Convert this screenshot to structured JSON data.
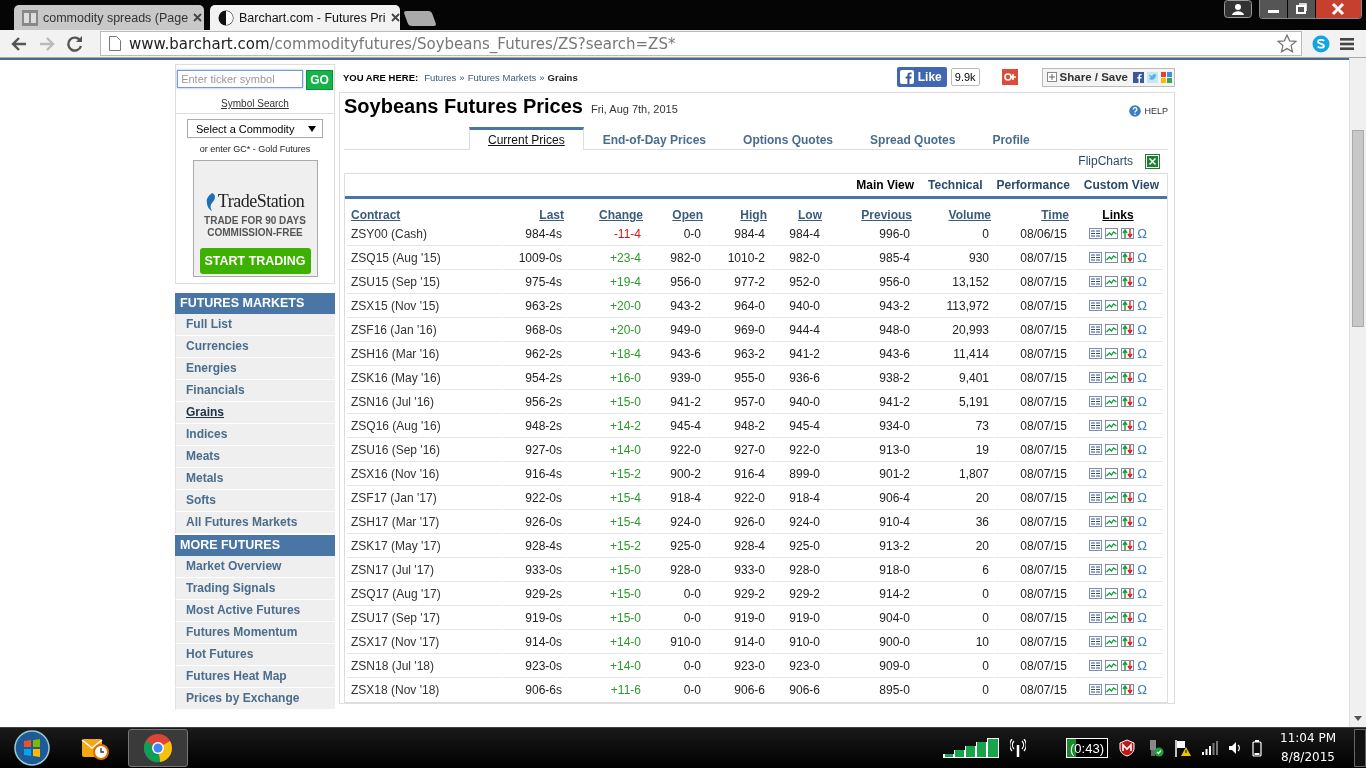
{
  "browser": {
    "tabs": [
      {
        "title": "commodity spreads (Page",
        "selected": false
      },
      {
        "title": "Barchart.com - Futures Pri",
        "selected": true
      }
    ],
    "url": {
      "host": "www.barchart.com",
      "path": "/commodityfutures/Soybeans_Futures/ZS?search=ZS*"
    }
  },
  "sidebar": {
    "search": {
      "placeholder": "Enter ticker symbol",
      "button": "GO"
    },
    "symbol_search": "Symbol Search",
    "commodity_select": "Select a Commodity",
    "hint": "or enter GC* - Gold Futures",
    "ad": {
      "brand": "TradeStation",
      "lines": [
        "TRADE FOR 90 DAYS",
        "COMMISSION-FREE"
      ],
      "button": "START TRADING"
    },
    "sections": [
      {
        "heading": "FUTURES MARKETS",
        "items": [
          {
            "label": "Full List",
            "selected": false
          },
          {
            "label": "Currencies",
            "selected": false
          },
          {
            "label": "Energies",
            "selected": false
          },
          {
            "label": "Financials",
            "selected": false
          },
          {
            "label": "Grains",
            "selected": true
          },
          {
            "label": "Indices",
            "selected": false
          },
          {
            "label": "Meats",
            "selected": false
          },
          {
            "label": "Metals",
            "selected": false
          },
          {
            "label": "Softs",
            "selected": false
          },
          {
            "label": "All Futures Markets",
            "selected": false
          }
        ]
      },
      {
        "heading": "MORE FUTURES",
        "items": [
          {
            "label": "Market Overview",
            "selected": false
          },
          {
            "label": "Trading Signals",
            "selected": false
          },
          {
            "label": "Most Active Futures",
            "selected": false
          },
          {
            "label": "Futures Momentum",
            "selected": false
          },
          {
            "label": "Hot Futures",
            "selected": false
          },
          {
            "label": "Futures Heat Map",
            "selected": false
          },
          {
            "label": "Prices by Exchange",
            "selected": false
          }
        ]
      }
    ]
  },
  "breadcrumb": {
    "lead": "YOU ARE HERE:",
    "items": [
      "Futures",
      "Futures Markets",
      "Grains"
    ],
    "separator": "»"
  },
  "social": {
    "like": "Like",
    "like_count": "9.9k",
    "share": "Share / Save"
  },
  "title": "Soybeans Futures Prices",
  "date": "Fri, Aug 7th, 2015",
  "help": "HELP",
  "tabs": [
    {
      "label": "Current Prices",
      "selected": true
    },
    {
      "label": "End-of-Day Prices",
      "selected": false
    },
    {
      "label": "Options Quotes",
      "selected": false
    },
    {
      "label": "Spread Quotes",
      "selected": false
    },
    {
      "label": "Profile",
      "selected": false
    }
  ],
  "flipcharts": "FlipCharts",
  "views": [
    {
      "label": "Main View",
      "selected": true
    },
    {
      "label": "Technical",
      "selected": false
    },
    {
      "label": "Performance",
      "selected": false
    },
    {
      "label": "Custom View",
      "selected": false
    }
  ],
  "table": {
    "columns": [
      "Contract",
      "Last",
      "Change",
      "Open",
      "High",
      "Low",
      "Previous",
      "Volume",
      "Time",
      "Links"
    ],
    "rows": [
      {
        "contract": "ZSY00 (Cash)",
        "last": "984-4s",
        "change": "-11-4",
        "color": "#e01010",
        "open": "0-0",
        "high": "984-4",
        "low": "984-4",
        "previous": "996-0",
        "volume": "0",
        "time": "08/06/15",
        "glyph": "Ω"
      },
      {
        "contract": "ZSQ15 (Aug '15)",
        "last": "1009-0s",
        "change": "+23-4",
        "color": "#2a9a2a",
        "open": "982-0",
        "high": "1010-2",
        "low": "982-0",
        "previous": "985-4",
        "volume": "930",
        "time": "08/07/15",
        "glyph": "Ω"
      },
      {
        "contract": "ZSU15 (Sep '15)",
        "last": "975-4s",
        "change": "+19-4",
        "color": "#2a9a2a",
        "open": "956-0",
        "high": "977-2",
        "low": "952-0",
        "previous": "956-0",
        "volume": "13,152",
        "time": "08/07/15",
        "glyph": "Ω"
      },
      {
        "contract": "ZSX15 (Nov '15)",
        "last": "963-2s",
        "change": "+20-0",
        "color": "#2a9a2a",
        "open": "943-2",
        "high": "964-0",
        "low": "940-0",
        "previous": "943-2",
        "volume": "113,972",
        "time": "08/07/15",
        "glyph": "Ω"
      },
      {
        "contract": "ZSF16 (Jan '16)",
        "last": "968-0s",
        "change": "+20-0",
        "color": "#2a9a2a",
        "open": "949-0",
        "high": "969-0",
        "low": "944-4",
        "previous": "948-0",
        "volume": "20,993",
        "time": "08/07/15",
        "glyph": "Ω"
      },
      {
        "contract": "ZSH16 (Mar '16)",
        "last": "962-2s",
        "change": "+18-4",
        "color": "#2a9a2a",
        "open": "943-6",
        "high": "963-2",
        "low": "941-2",
        "previous": "943-6",
        "volume": "11,414",
        "time": "08/07/15",
        "glyph": "Ω"
      },
      {
        "contract": "ZSK16 (May '16)",
        "last": "954-2s",
        "change": "+16-0",
        "color": "#2a9a2a",
        "open": "939-0",
        "high": "955-0",
        "low": "936-6",
        "previous": "938-2",
        "volume": "9,401",
        "time": "08/07/15",
        "glyph": "Ω"
      },
      {
        "contract": "ZSN16 (Jul '16)",
        "last": "956-2s",
        "change": "+15-0",
        "color": "#2a9a2a",
        "open": "941-2",
        "high": "957-0",
        "low": "940-0",
        "previous": "941-2",
        "volume": "5,191",
        "time": "08/07/15",
        "glyph": "Ω"
      },
      {
        "contract": "ZSQ16 (Aug '16)",
        "last": "948-2s",
        "change": "+14-2",
        "color": "#2a9a2a",
        "open": "945-4",
        "high": "948-2",
        "low": "945-4",
        "previous": "934-0",
        "volume": "73",
        "time": "08/07/15",
        "glyph": "Ω"
      },
      {
        "contract": "ZSU16 (Sep '16)",
        "last": "927-0s",
        "change": "+14-0",
        "color": "#2a9a2a",
        "open": "922-0",
        "high": "927-0",
        "low": "922-0",
        "previous": "913-0",
        "volume": "19",
        "time": "08/07/15",
        "glyph": "Ω"
      },
      {
        "contract": "ZSX16 (Nov '16)",
        "last": "916-4s",
        "change": "+15-2",
        "color": "#2a9a2a",
        "open": "900-2",
        "high": "916-4",
        "low": "899-0",
        "previous": "901-2",
        "volume": "1,807",
        "time": "08/07/15",
        "glyph": "Ω"
      },
      {
        "contract": "ZSF17 (Jan '17)",
        "last": "922-0s",
        "change": "+15-4",
        "color": "#2a9a2a",
        "open": "918-4",
        "high": "922-0",
        "low": "918-4",
        "previous": "906-4",
        "volume": "20",
        "time": "08/07/15",
        "glyph": "Ω"
      },
      {
        "contract": "ZSH17 (Mar '17)",
        "last": "926-0s",
        "change": "+15-4",
        "color": "#2a9a2a",
        "open": "924-0",
        "high": "926-0",
        "low": "924-0",
        "previous": "910-4",
        "volume": "36",
        "time": "08/07/15",
        "glyph": "Ω"
      },
      {
        "contract": "ZSK17 (May '17)",
        "last": "928-4s",
        "change": "+15-2",
        "color": "#2a9a2a",
        "open": "925-0",
        "high": "928-4",
        "low": "925-0",
        "previous": "913-2",
        "volume": "20",
        "time": "08/07/15",
        "glyph": "Ω"
      },
      {
        "contract": "ZSN17 (Jul '17)",
        "last": "933-0s",
        "change": "+15-0",
        "color": "#2a9a2a",
        "open": "928-0",
        "high": "933-0",
        "low": "928-0",
        "previous": "918-0",
        "volume": "6",
        "time": "08/07/15",
        "glyph": "Ω"
      },
      {
        "contract": "ZSQ17 (Aug '17)",
        "last": "929-2s",
        "change": "+15-0",
        "color": "#2a9a2a",
        "open": "0-0",
        "high": "929-2",
        "low": "929-2",
        "previous": "914-2",
        "volume": "0",
        "time": "08/07/15",
        "glyph": "Ω"
      },
      {
        "contract": "ZSU17 (Sep '17)",
        "last": "919-0s",
        "change": "+15-0",
        "color": "#2a9a2a",
        "open": "0-0",
        "high": "919-0",
        "low": "919-0",
        "previous": "904-0",
        "volume": "0",
        "time": "08/07/15",
        "glyph": "Ω"
      },
      {
        "contract": "ZSX17 (Nov '17)",
        "last": "914-0s",
        "change": "+14-0",
        "color": "#2a9a2a",
        "open": "910-0",
        "high": "914-0",
        "low": "910-0",
        "previous": "900-0",
        "volume": "10",
        "time": "08/07/15",
        "glyph": "Ω"
      },
      {
        "contract": "ZSN18 (Jul '18)",
        "last": "923-0s",
        "change": "+14-0",
        "color": "#2a9a2a",
        "open": "0-0",
        "high": "923-0",
        "low": "923-0",
        "previous": "909-0",
        "volume": "0",
        "time": "08/07/15",
        "glyph": "Ω"
      },
      {
        "contract": "ZSX18 (Nov '18)",
        "last": "906-6s",
        "change": "+11-6",
        "color": "#2a9a2a",
        "open": "0-0",
        "high": "906-6",
        "low": "906-6",
        "previous": "895-0",
        "volume": "0",
        "time": "08/07/15",
        "glyph": "Ω"
      }
    ]
  },
  "taskbar": {
    "battery": "(0:43)",
    "time": "11:04 PM",
    "date": "8/8/2015"
  }
}
